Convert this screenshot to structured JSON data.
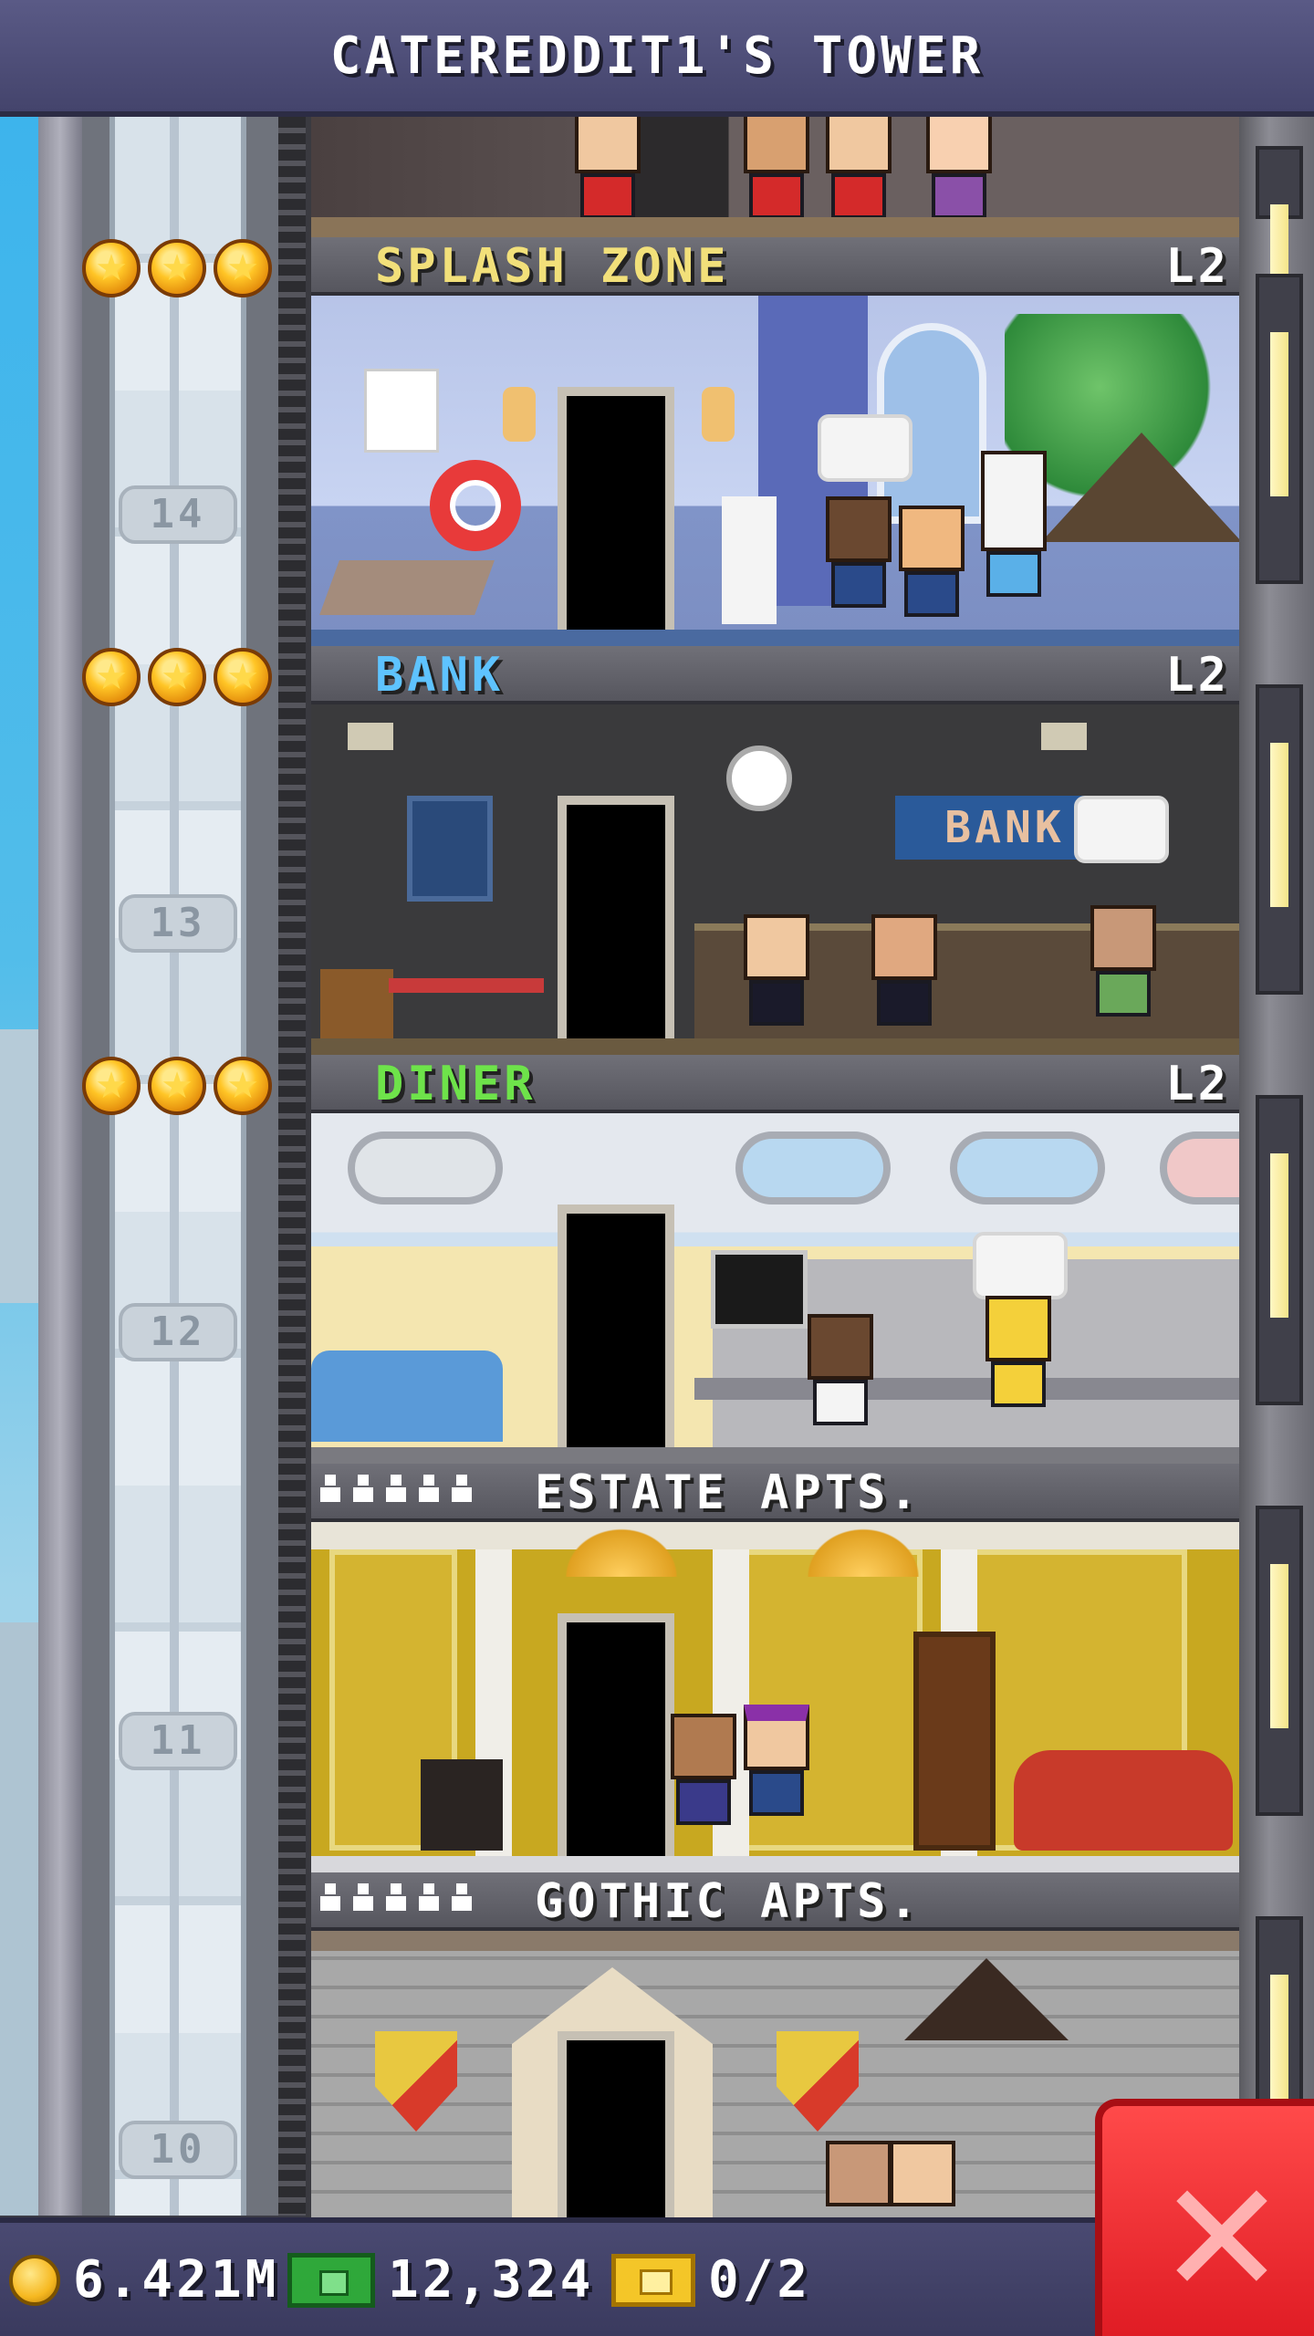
{
  "header": {
    "title": "CATEREDDIT1'S TOWER"
  },
  "colors": {
    "splash_zone": "#f2e07a",
    "bank": "#5ec3ff",
    "diner": "#6ee34a",
    "apartment": "#ffffff",
    "close_button": "#e8232c"
  },
  "elevator": {
    "floor_numbers": [
      "14",
      "13",
      "12",
      "11",
      "10"
    ]
  },
  "floors": [
    {
      "name": "SPLASH ZONE",
      "level": "L2",
      "stars": 3,
      "floor_number": "14"
    },
    {
      "name": "BANK",
      "level": "L2",
      "stars": 3,
      "floor_number": "13"
    },
    {
      "name": "DINER",
      "level": "L2",
      "stars": 3,
      "floor_number": "12"
    },
    {
      "name": "ESTATE APTS.",
      "residents": 5,
      "floor_number": "11"
    },
    {
      "name": "GOTHIC APTS.",
      "residents": 5,
      "floor_number": "10"
    }
  ],
  "room_art": {
    "bank_sign": "BANK"
  },
  "currency": {
    "coins": "6.421M",
    "bux": "12,324",
    "tickets": "0/2"
  },
  "icons": {
    "star": "star-icon",
    "coin": "coin-icon",
    "bux": "bux-icon",
    "ticket": "ticket-icon",
    "close": "close-icon",
    "resident": "person-icon"
  }
}
